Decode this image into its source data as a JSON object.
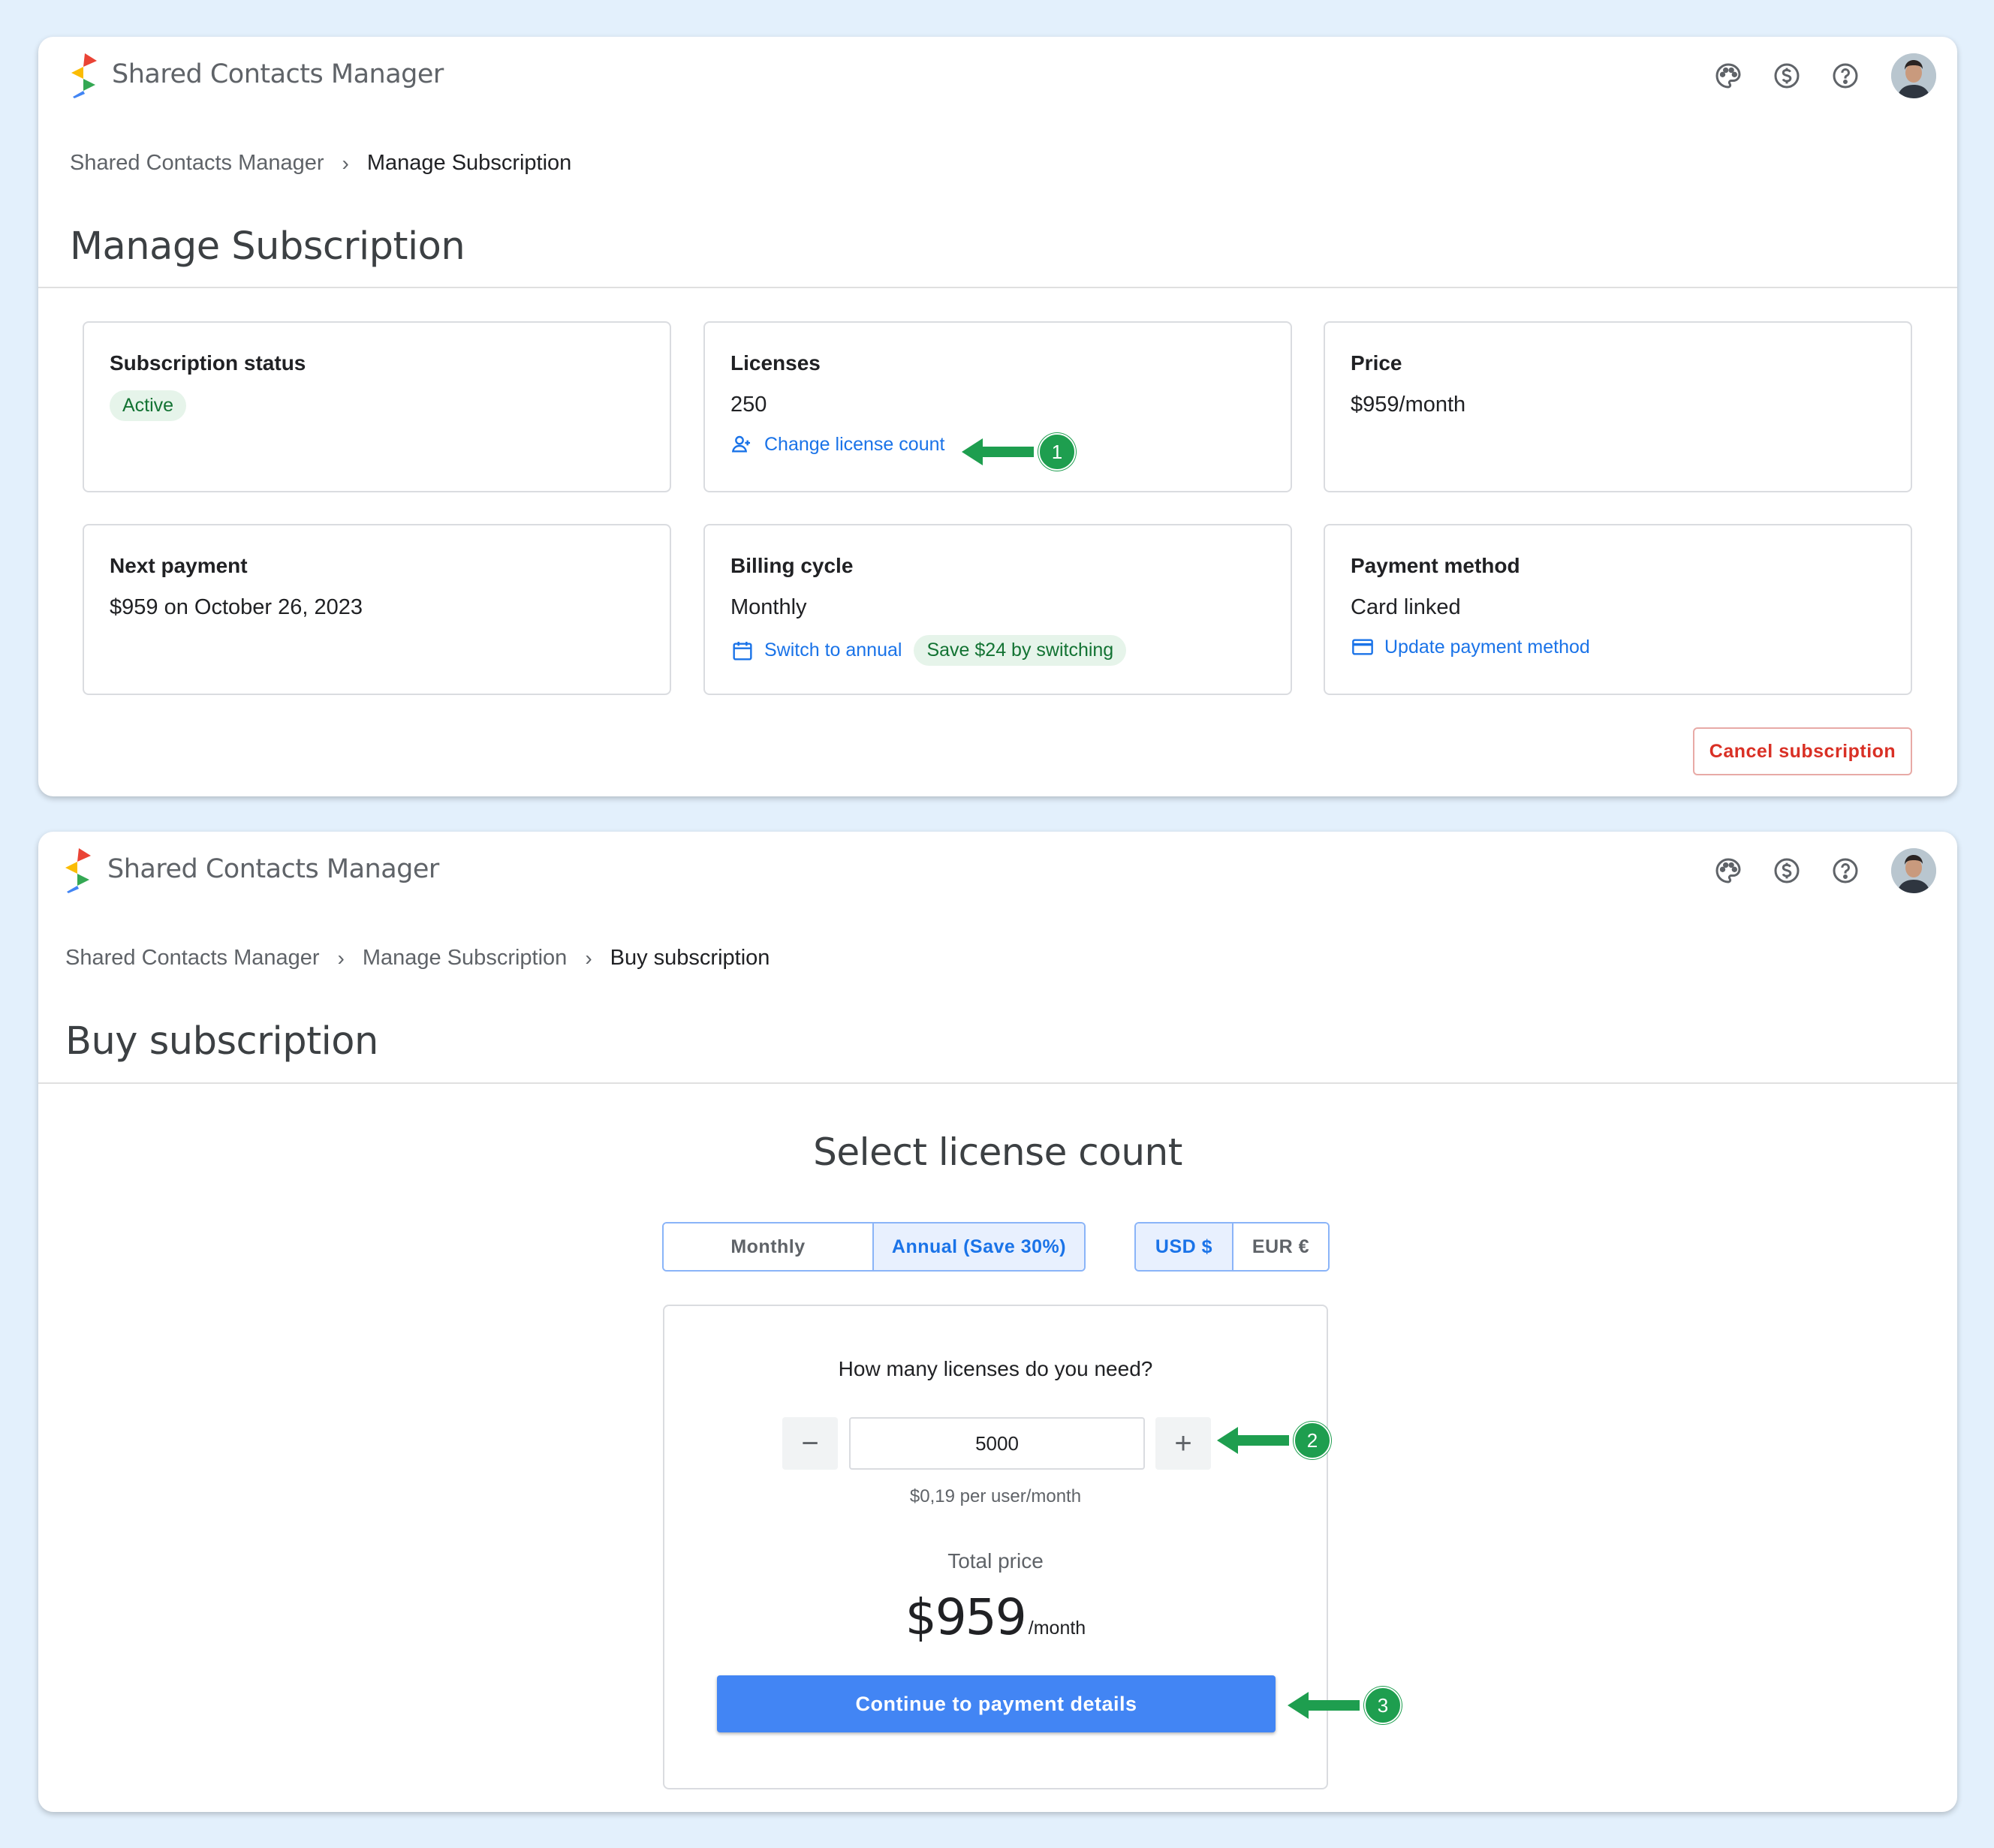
{
  "app": {
    "name": "Shared Contacts Manager",
    "icons": [
      "palette-icon",
      "dollar-circle-icon",
      "help-icon",
      "user-avatar"
    ]
  },
  "manage": {
    "breadcrumb": [
      "Shared Contacts Manager",
      "Manage Subscription"
    ],
    "title": "Manage Subscription",
    "cards": {
      "status": {
        "title": "Subscription status",
        "badge": "Active"
      },
      "licenses": {
        "title": "Licenses",
        "value": "250",
        "link": "Change license count"
      },
      "price": {
        "title": "Price",
        "value": "$959/month"
      },
      "next_payment": {
        "title": "Next payment",
        "value": "$959 on October 26, 2023"
      },
      "billing": {
        "title": "Billing cycle",
        "value": "Monthly",
        "link": "Switch to annual",
        "badge": "Save $24 by switching"
      },
      "payment": {
        "title": "Payment method",
        "value": "Card linked",
        "link": "Update payment method"
      }
    },
    "cancel_label": "Cancel subscription"
  },
  "buy": {
    "breadcrumb": [
      "Shared Contacts Manager",
      "Manage Subscription",
      "Buy subscription"
    ],
    "title": "Buy subscription",
    "section_title": "Select license count",
    "cycle_options": [
      "Monthly",
      "Annual (Save 30%)"
    ],
    "cycle_selected": "Annual (Save 30%)",
    "currency_options": [
      "USD $",
      "EUR €"
    ],
    "currency_selected": "USD $",
    "question": "How many licenses do you need?",
    "quantity": "5000",
    "minus": "−",
    "plus": "+",
    "per_user": "$0,19 per user/month",
    "total_label": "Total price",
    "total_price": "$959",
    "total_unit": "/month",
    "continue_label": "Continue to payment details"
  },
  "annotations": [
    "1",
    "2",
    "3"
  ],
  "colors": {
    "background": "#e3f0fc",
    "link": "#1a73e8",
    "primary_button": "#4285f4",
    "annotation": "#1e9e4f",
    "danger": "#d93025",
    "chip_bg": "#e6f4ea",
    "chip_text": "#137333"
  }
}
